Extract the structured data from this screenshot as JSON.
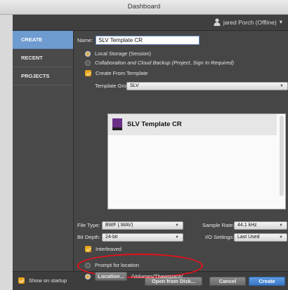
{
  "window": {
    "title": "Dashboard"
  },
  "userbar": {
    "user_label": "jared Porch (Offline)",
    "arrow": "▾"
  },
  "sidebar": {
    "items": [
      {
        "label": "CREATE"
      },
      {
        "label": "RECENT"
      },
      {
        "label": "PROJECTS"
      }
    ]
  },
  "form": {
    "name_label": "Name:",
    "name_value": "SLV Template CR",
    "storage_local": "Local Storage (Session)",
    "storage_cloud": "Collaboration and Cloud Backup (Project, Sign In Required)",
    "create_from_template": "Create From Template",
    "template_group_label": "Template Group:",
    "template_group_value": "SLV",
    "template_item": "SLV Template CR",
    "file_type_label": "File Type:",
    "file_type_value": "BWF (.WAV)",
    "sample_rate_label": "Sample Rate:",
    "sample_rate_value": "44.1 kHz",
    "bit_depth_label": "Bit Depth:",
    "bit_depth_value": "24-bit",
    "io_label": "I/O Settings:",
    "io_value": "Last Used",
    "interleaved": "Interleaved",
    "prompt_location": "Prompt for location",
    "location_button": "Location...",
    "location_path": "/Volumes/Thawspace/"
  },
  "footer": {
    "show_on_startup": "Show on startup",
    "open_from_disk": "Open from Disk...",
    "cancel": "Cancel",
    "create": "Create"
  },
  "colors": {
    "accent": "#6e9bd0",
    "checkbox": "#e8a317",
    "highlight": "#e8101a",
    "primary_button": "#3a78c8"
  }
}
